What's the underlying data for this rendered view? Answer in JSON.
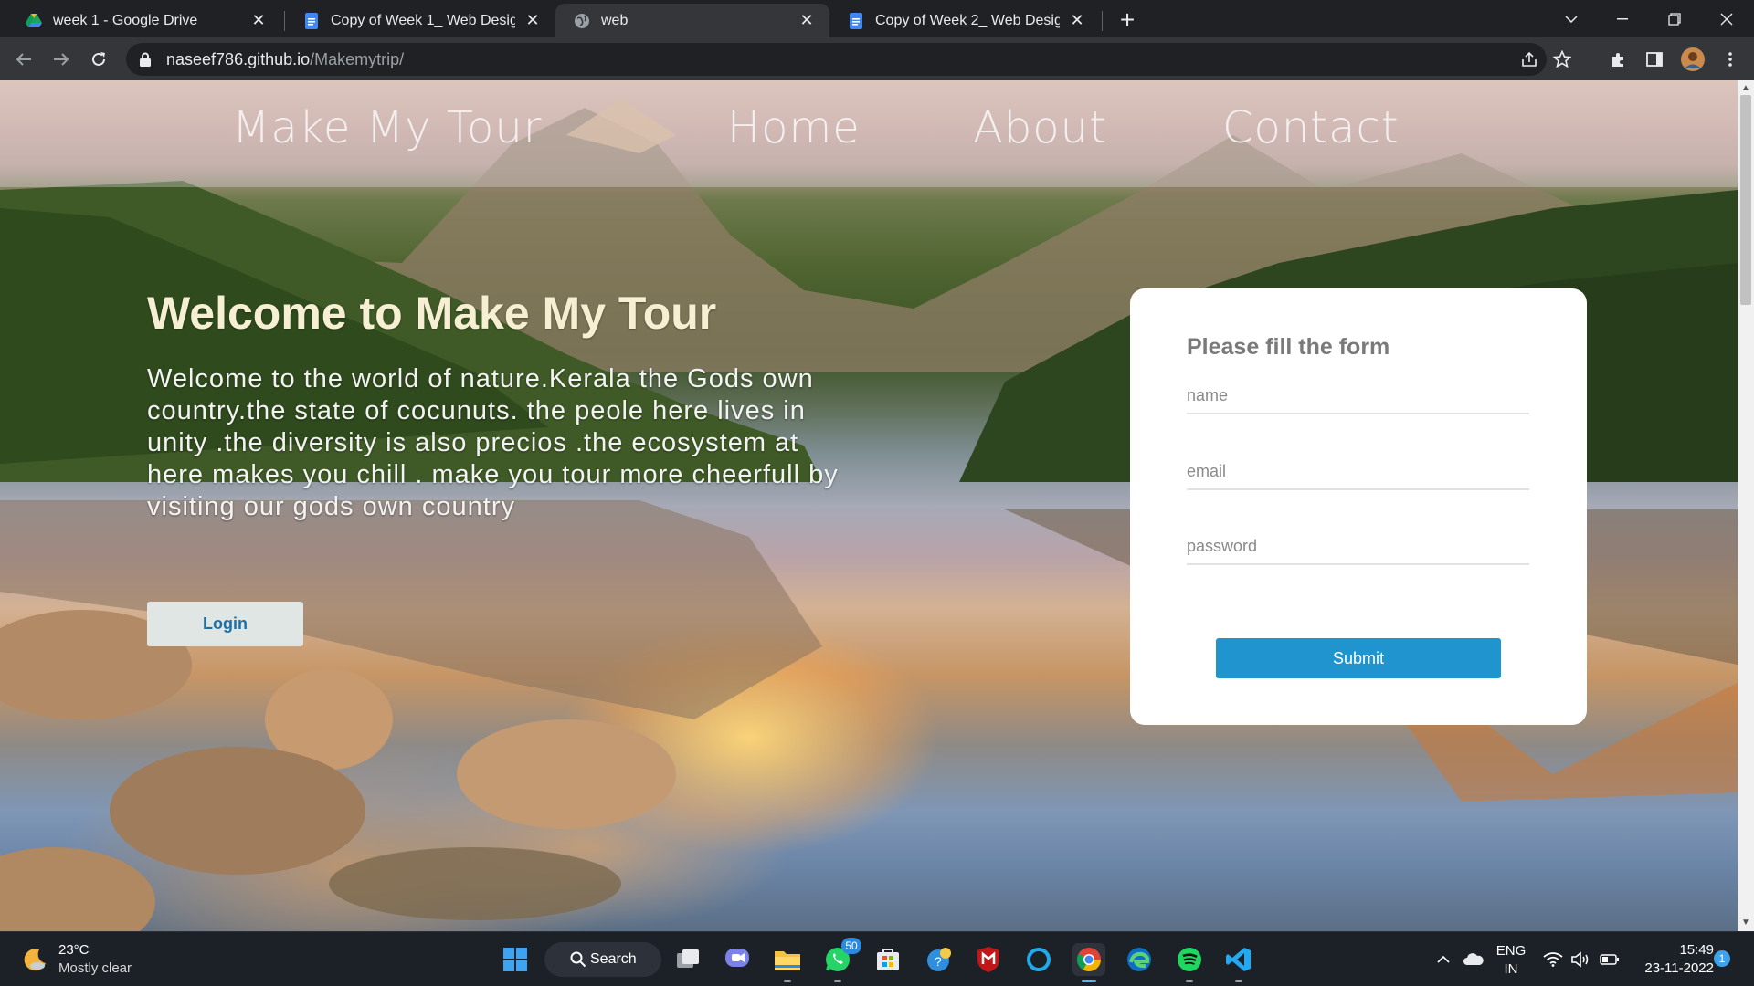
{
  "browser": {
    "tabs": [
      {
        "title": "week 1 - Google Drive",
        "favicon": "google-drive-icon",
        "active": false
      },
      {
        "title": "Copy of Week 1_ Web Designing",
        "favicon": "google-docs-icon",
        "active": false
      },
      {
        "title": "web",
        "favicon": "globe-icon",
        "active": true
      },
      {
        "title": "Copy of Week 2_ Web Designing",
        "favicon": "google-docs-icon",
        "active": false
      }
    ],
    "url_host": "naseef786.github.io",
    "url_path": "/Makemytrip/"
  },
  "page": {
    "nav": {
      "brand": "Make My Tour",
      "links": [
        "Home",
        "About",
        "Contact"
      ]
    },
    "hero": {
      "title": "Welcome to Make My Tour",
      "text": "Welcome to the world of nature.Kerala the Gods own country.the state of cocunuts. the peole here lives in unity .the diversity is also precios .the ecosystem at here makes you chill . make you tour more cheerfull by visiting our gods own country",
      "login_label": "Login"
    },
    "form": {
      "title": "Please fill the form",
      "name_placeholder": "name",
      "email_placeholder": "email",
      "password_placeholder": "password",
      "submit_label": "Submit"
    }
  },
  "taskbar": {
    "weather_temp": "23°C",
    "weather_desc": "Mostly clear",
    "search_label": "Search",
    "whatsapp_badge": "50",
    "lang": "ENG",
    "region": "IN",
    "time": "15:49",
    "date": "23-11-2022",
    "notification_count": "1"
  },
  "colors": {
    "submit": "#1f94cf",
    "login_text": "#1e6fa4",
    "hero_title": "#f7efd4"
  }
}
